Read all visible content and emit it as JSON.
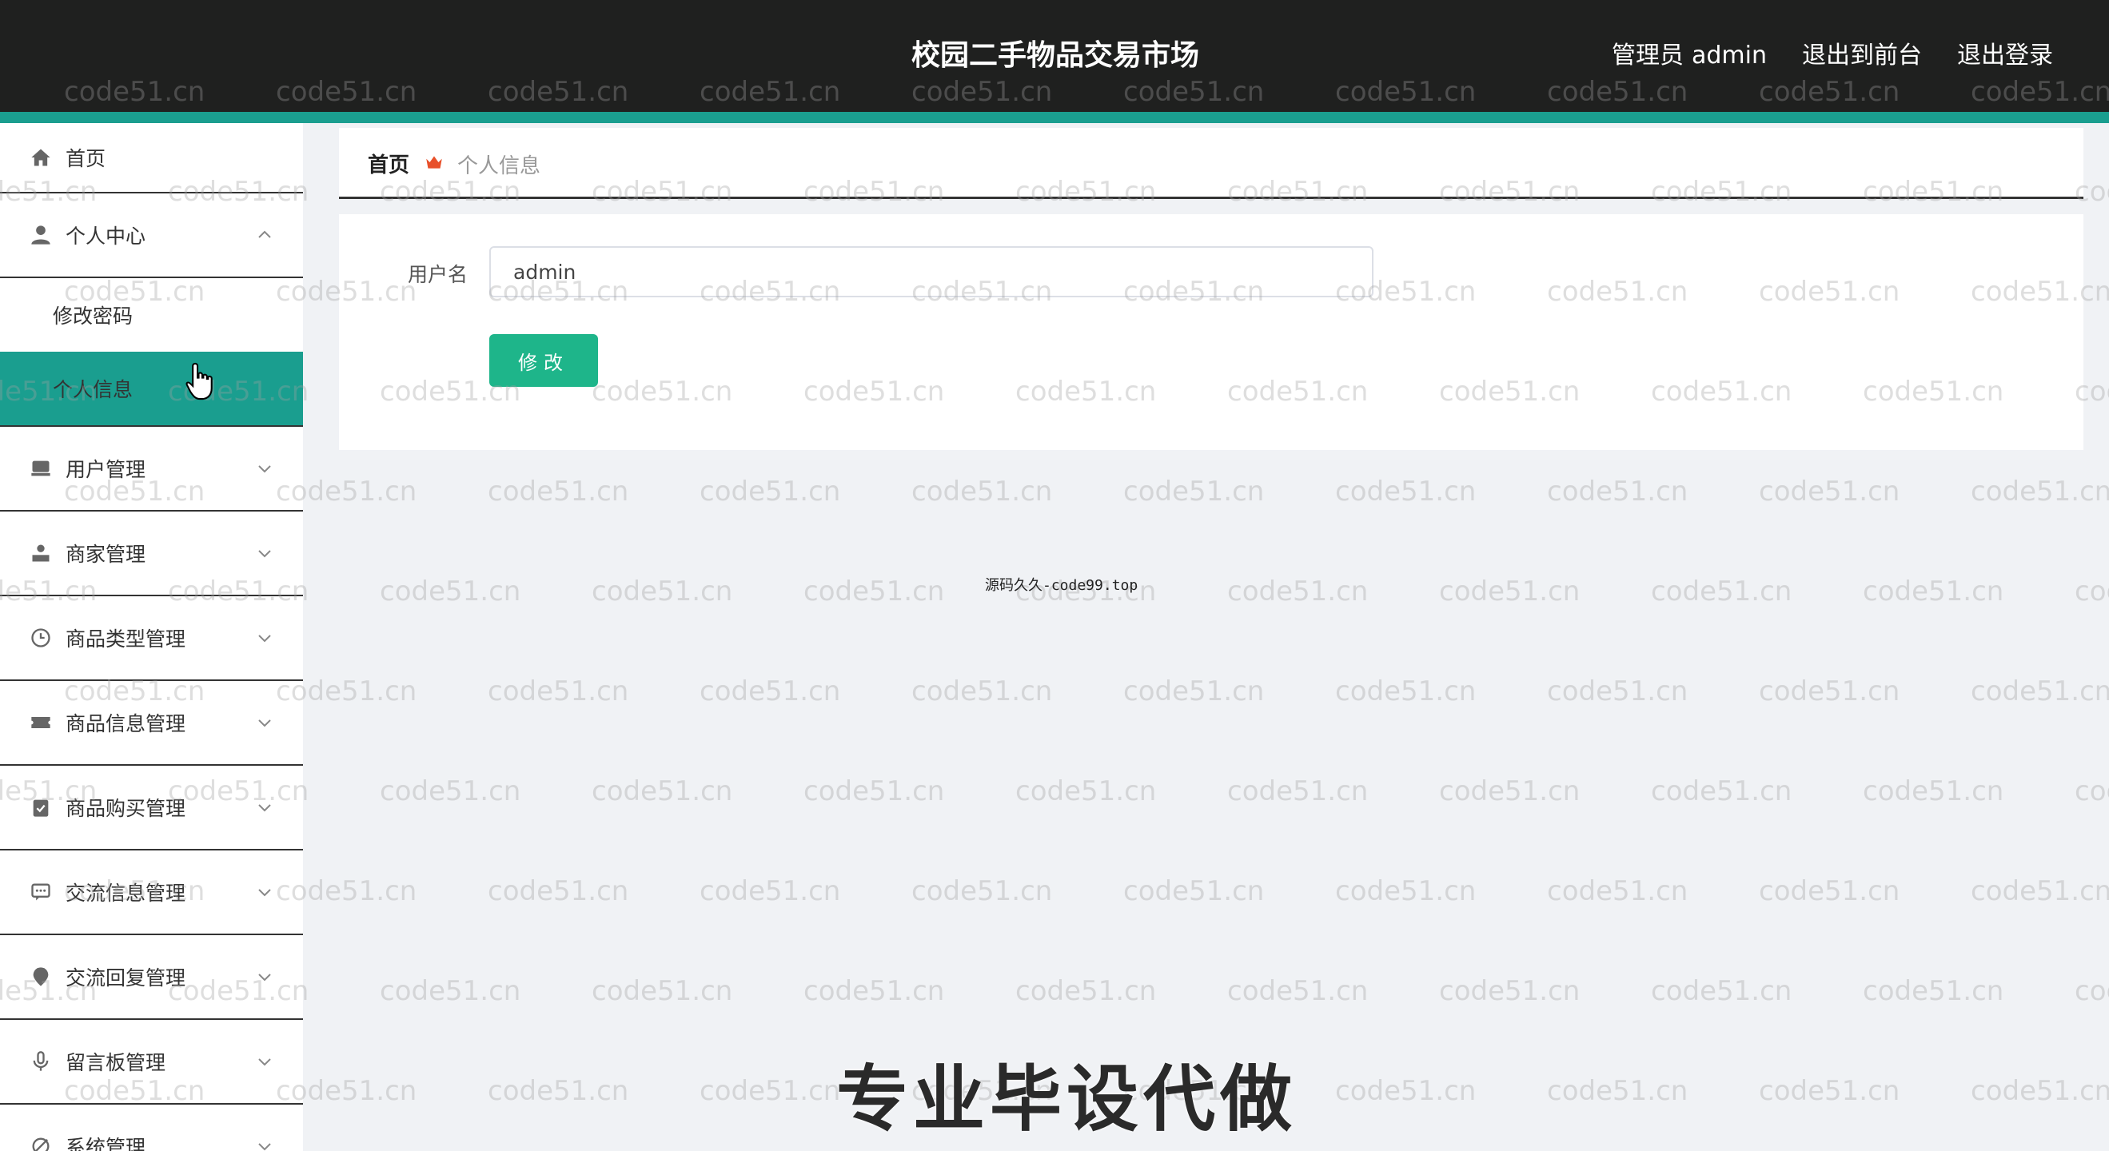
{
  "header": {
    "title": "校园二手物品交易市场",
    "role": "管理员",
    "username": "admin",
    "exit_front": "退出到前台",
    "logout": "退出登录"
  },
  "sidebar": {
    "items": [
      {
        "label": "首页",
        "icon": "home-icon"
      },
      {
        "label": "个人中心",
        "icon": "user-icon",
        "expanded": true,
        "children": [
          {
            "label": "修改密码"
          },
          {
            "label": "个人信息",
            "active": true
          }
        ]
      },
      {
        "label": "用户管理",
        "icon": "users-icon"
      },
      {
        "label": "商家管理",
        "icon": "merchant-icon"
      },
      {
        "label": "商品类型管理",
        "icon": "clock-icon"
      },
      {
        "label": "商品信息管理",
        "icon": "ticket-icon"
      },
      {
        "label": "商品购买管理",
        "icon": "clipboard-icon"
      },
      {
        "label": "交流信息管理",
        "icon": "chat-icon"
      },
      {
        "label": "交流回复管理",
        "icon": "location-icon"
      },
      {
        "label": "留言板管理",
        "icon": "microphone-icon"
      },
      {
        "label": "系统管理",
        "icon": "settings-icon"
      }
    ]
  },
  "breadcrumb": {
    "home": "首页",
    "current": "个人信息"
  },
  "form": {
    "username_label": "用户名",
    "username_value": "admin",
    "submit_label": "修改"
  },
  "overlay": {
    "center_note": "源码久久-code99.top",
    "promo": "专业毕设代做",
    "watermark": "code51.cn"
  },
  "colors": {
    "header_bg": "#1f201f",
    "accent": "#1a9e8f",
    "button": "#1eb58a"
  }
}
